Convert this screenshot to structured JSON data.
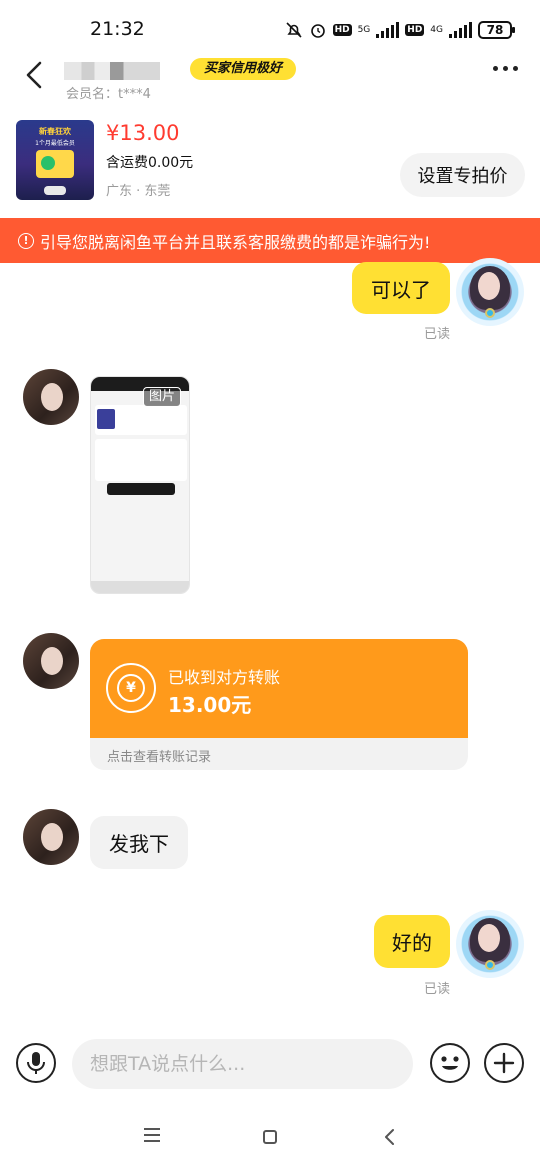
{
  "status_bar": {
    "time": "21:32",
    "network_5g": "5G",
    "network_4g": "4G",
    "hd": "HD",
    "battery": "78"
  },
  "header": {
    "credit_badge": "买家信用极好",
    "member_label": "会员名：t***4"
  },
  "product": {
    "image_title": "新春狂欢",
    "image_subtitle": "1个月最低会员",
    "price": "¥13.00",
    "shipping": "含运费0.00元",
    "location": "广东 · 东莞",
    "set_price_button": "设置专拍价"
  },
  "warning": {
    "text": "引导您脱离闲鱼平台并且联系客服缴费的都是诈骗行为!"
  },
  "messages": [
    {
      "sender": "self",
      "type": "text",
      "text": "可以了",
      "status": "已读"
    },
    {
      "sender": "other",
      "type": "image",
      "tag": "图片"
    },
    {
      "sender": "other",
      "type": "transfer",
      "title": "已收到对方转账",
      "amount": "13.00元",
      "link": "点击查看转账记录"
    },
    {
      "sender": "other",
      "type": "text",
      "text": "发我下"
    },
    {
      "sender": "self",
      "type": "text",
      "text": "好的",
      "status": "已读"
    }
  ],
  "input_bar": {
    "placeholder": "想跟TA说点什么..."
  },
  "colors": {
    "accent_yellow": "#ffe033",
    "warning_red": "#ff5a32",
    "price_red": "#ff3b30",
    "transfer_orange": "#ff9a1b"
  }
}
